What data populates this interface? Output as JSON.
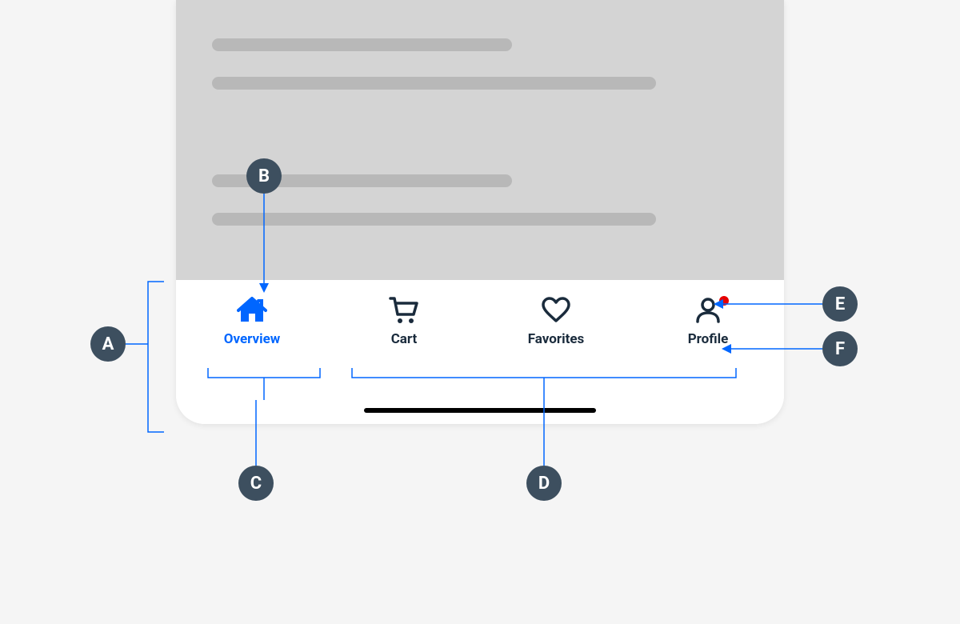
{
  "callouts": {
    "A": "A",
    "B": "B",
    "C": "C",
    "D": "D",
    "E": "E",
    "F": "F"
  },
  "tabs": [
    {
      "label": "Overview",
      "icon": "home",
      "active": true,
      "badge": false
    },
    {
      "label": "Cart",
      "icon": "cart",
      "active": false,
      "badge": false
    },
    {
      "label": "Favorites",
      "icon": "heart",
      "active": false,
      "badge": false
    },
    {
      "label": "Profile",
      "icon": "person",
      "active": false,
      "badge": true
    }
  ],
  "colors": {
    "active": "#0066ff",
    "inactive": "#1a2b3c",
    "badge": "#e60000",
    "callout_bg": "#3d4f5f"
  }
}
